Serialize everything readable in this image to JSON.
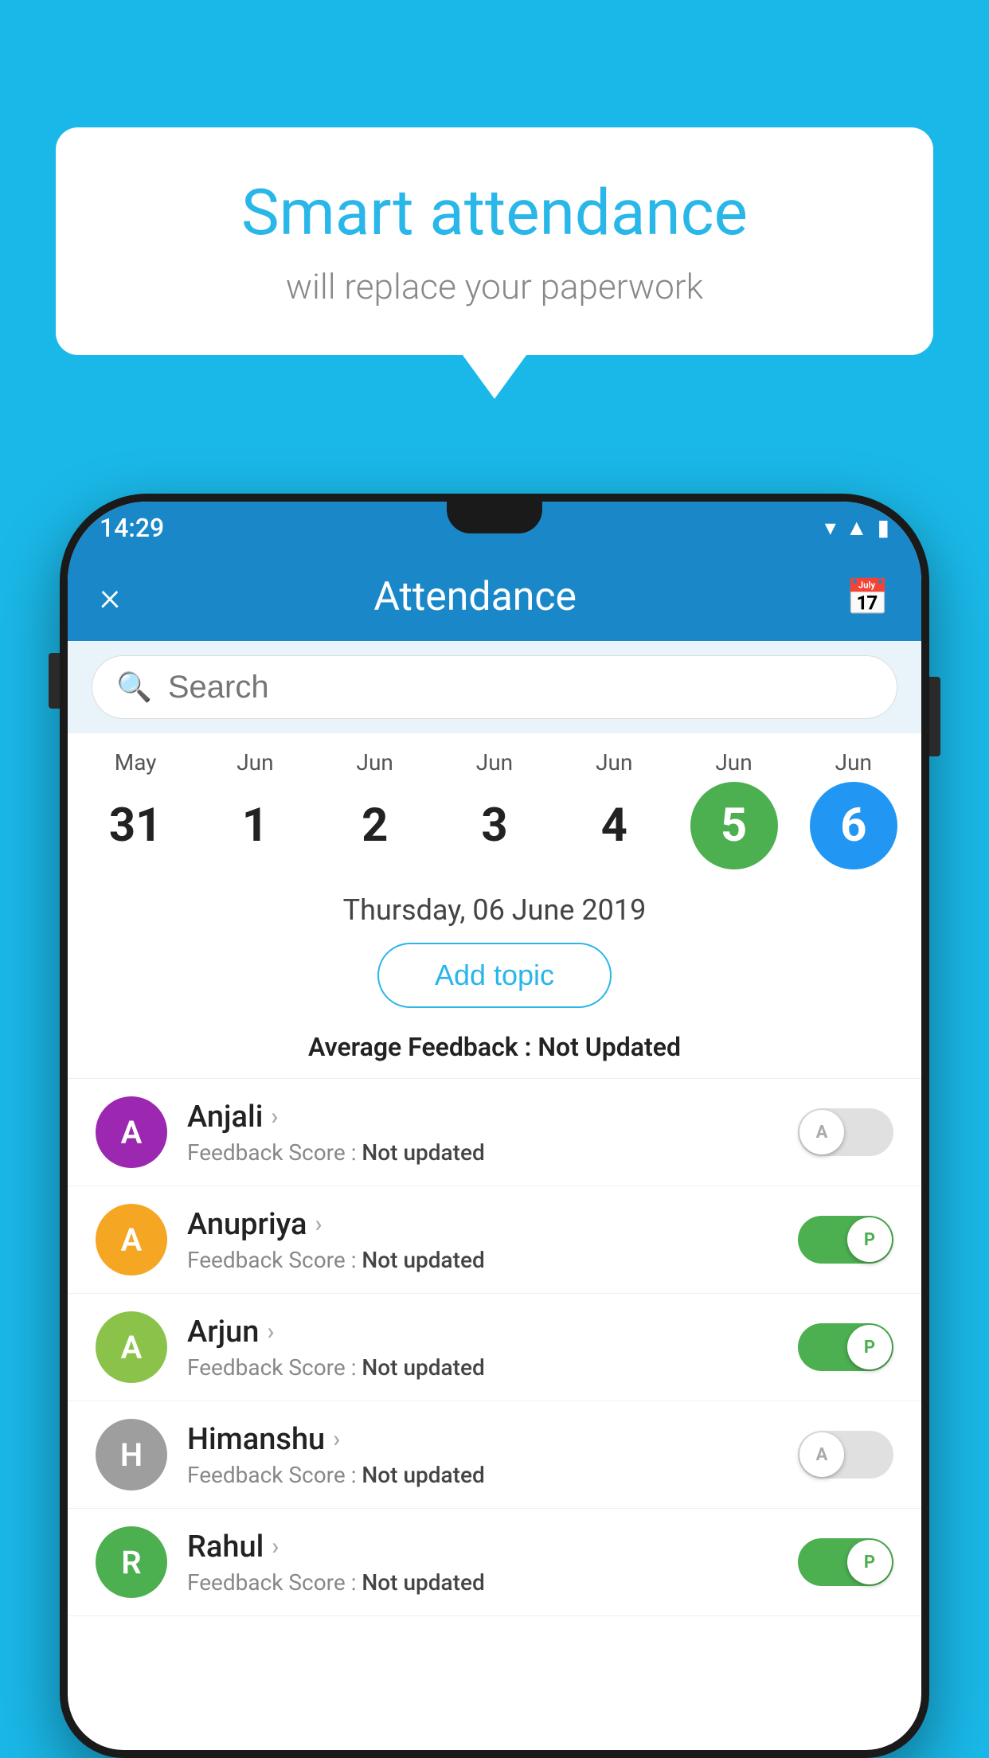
{
  "background_color": "#1ab8e8",
  "speech_bubble": {
    "title": "Smart attendance",
    "subtitle": "will replace your paperwork"
  },
  "status_bar": {
    "time": "14:29",
    "icons": [
      "wifi",
      "signal",
      "battery"
    ]
  },
  "app_bar": {
    "title": "Attendance",
    "close_label": "×",
    "calendar_icon": "📅"
  },
  "search": {
    "placeholder": "Search"
  },
  "dates": [
    {
      "month": "May",
      "day": "31",
      "style": "normal"
    },
    {
      "month": "Jun",
      "day": "1",
      "style": "normal"
    },
    {
      "month": "Jun",
      "day": "2",
      "style": "normal"
    },
    {
      "month": "Jun",
      "day": "3",
      "style": "normal"
    },
    {
      "month": "Jun",
      "day": "4",
      "style": "normal"
    },
    {
      "month": "Jun",
      "day": "5",
      "style": "today"
    },
    {
      "month": "Jun",
      "day": "6",
      "style": "selected"
    }
  ],
  "date_label": "Thursday, 06 June 2019",
  "add_topic_btn": "Add topic",
  "avg_feedback_label": "Average Feedback : ",
  "avg_feedback_value": "Not Updated",
  "students": [
    {
      "name": "Anjali",
      "avatar_letter": "A",
      "avatar_color": "#9c27b0",
      "feedback_label": "Feedback Score : ",
      "feedback_value": "Not updated",
      "status": "absent",
      "toggle_label": "A"
    },
    {
      "name": "Anupriya",
      "avatar_letter": "A",
      "avatar_color": "#f5a623",
      "feedback_label": "Feedback Score : ",
      "feedback_value": "Not updated",
      "status": "present",
      "toggle_label": "P"
    },
    {
      "name": "Arjun",
      "avatar_letter": "A",
      "avatar_color": "#8bc34a",
      "feedback_label": "Feedback Score : ",
      "feedback_value": "Not updated",
      "status": "present",
      "toggle_label": "P"
    },
    {
      "name": "Himanshu",
      "avatar_letter": "H",
      "avatar_color": "#9e9e9e",
      "feedback_label": "Feedback Score : ",
      "feedback_value": "Not updated",
      "status": "absent",
      "toggle_label": "A"
    },
    {
      "name": "Rahul",
      "avatar_letter": "R",
      "avatar_color": "#4caf50",
      "feedback_label": "Feedback Score : ",
      "feedback_value": "Not updated",
      "status": "present",
      "toggle_label": "P"
    }
  ]
}
